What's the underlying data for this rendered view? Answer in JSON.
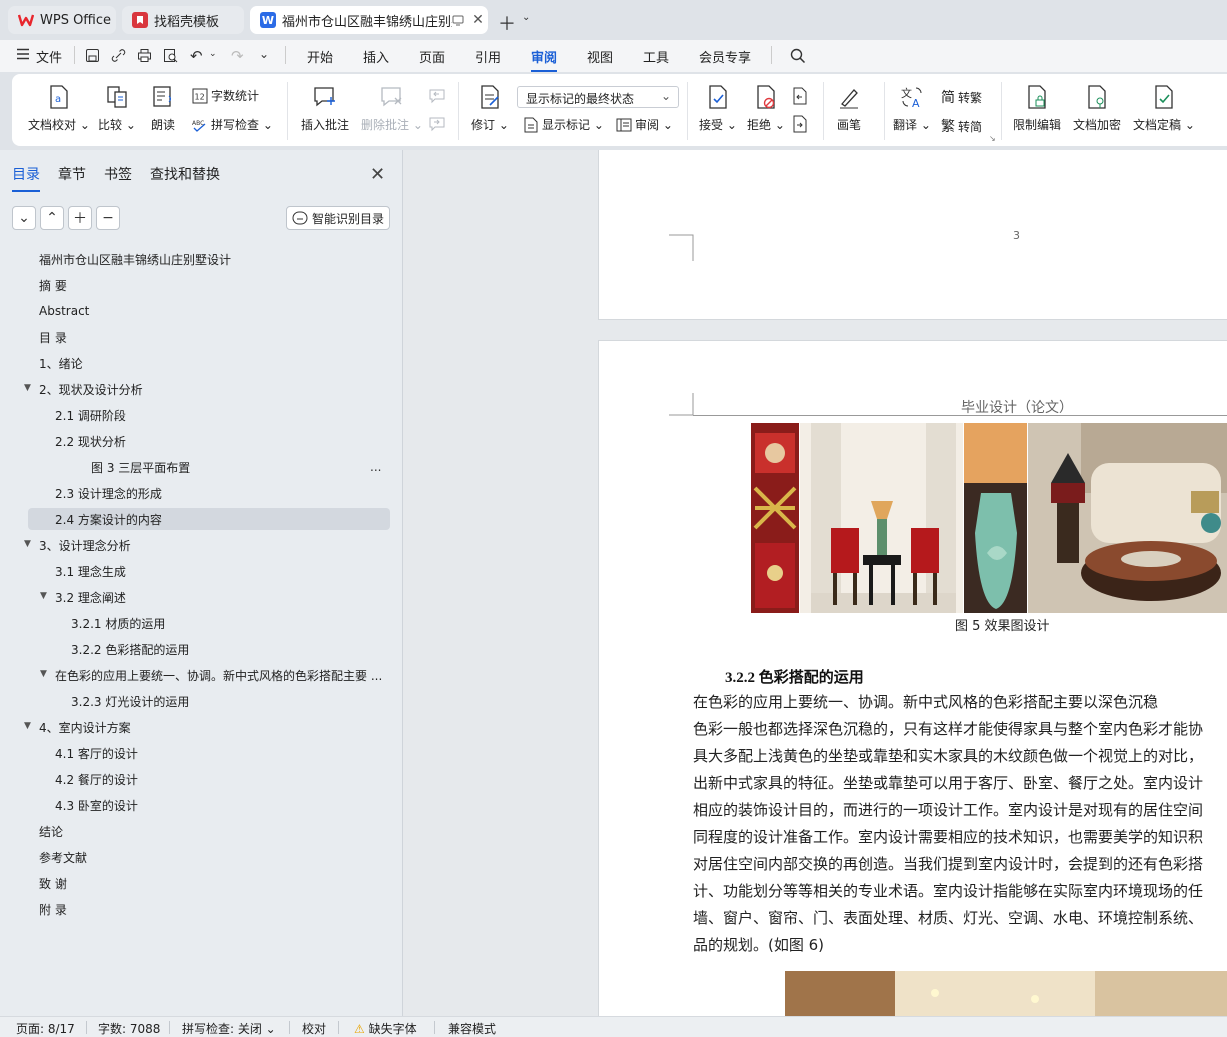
{
  "tabs": [
    {
      "label": "WPS Office"
    },
    {
      "label": "找稻壳模板"
    },
    {
      "label": "福州市仓山区融丰锦绣山庄别墅"
    }
  ],
  "menu": {
    "file": "文件",
    "items": [
      "开始",
      "插入",
      "页面",
      "引用",
      "审阅",
      "视图",
      "工具",
      "会员专享"
    ],
    "active": "审阅"
  },
  "ribbon": {
    "doc_check": "文档校对",
    "compare": "比较",
    "read_aloud": "朗读",
    "word_count": "字数统计",
    "spell_check": "拼写检查",
    "insert_comment": "插入批注",
    "delete_comment": "删除批注",
    "revise": "修订",
    "show_markup_state": "显示标记的最终状态",
    "show_markup": "显示标记",
    "review": "审阅",
    "accept": "接受",
    "reject": "拒绝",
    "pen": "画笔",
    "translate": "翻译",
    "to_traditional": "转繁",
    "to_simplified": "转简",
    "restrict_edit": "限制编辑",
    "encrypt": "文档加密",
    "finalize": "文档定稿",
    "trad_char": "简",
    "simp_char": "繁"
  },
  "nav": {
    "tabs": [
      "目录",
      "章节",
      "书签",
      "查找和替换"
    ],
    "smart_toc": "智能识别目录",
    "toc": [
      {
        "label": "福州市仓山区融丰锦绣山庄别墅设计",
        "level": 1
      },
      {
        "label": "摘    要",
        "level": 1
      },
      {
        "label": "Abstract",
        "level": 1
      },
      {
        "label": "目  录",
        "level": 1
      },
      {
        "label": "1、绪论",
        "level": 1
      },
      {
        "label": "2、现状及设计分析",
        "level": 1,
        "expanded": true
      },
      {
        "label": "2.1 调研阶段",
        "level": 2
      },
      {
        "label": "2.2 现状分析",
        "level": 2
      },
      {
        "label": "图 3 三层平面布置",
        "level": 4
      },
      {
        "label": "2.3 设计理念的形成",
        "level": 2
      },
      {
        "label": "2.4 方案设计的内容",
        "level": 2,
        "current": true
      },
      {
        "label": "3、设计理念分析",
        "level": 1,
        "expanded": true
      },
      {
        "label": "3.1 理念生成",
        "level": 2
      },
      {
        "label": "3.2 理念阐述",
        "level": 2,
        "expanded": true
      },
      {
        "label": "3.2.1 材质的运用",
        "level": 3
      },
      {
        "label": "3.2.2 色彩搭配的运用",
        "level": 3
      },
      {
        "label": "在色彩的应用上要统一、协调。新中式风格的色彩搭配主要 ...",
        "level": 2,
        "expanded": true
      },
      {
        "label": "3.2.3 灯光设计的运用",
        "level": 3
      },
      {
        "label": "4、室内设计方案",
        "level": 1,
        "expanded": true
      },
      {
        "label": "4.1 客厅的设计",
        "level": 2
      },
      {
        "label": "4.2 餐厅的设计",
        "level": 2
      },
      {
        "label": "4.3 卧室的设计",
        "level": 2
      },
      {
        "label": "结论",
        "level": 1
      },
      {
        "label": "参考文献",
        "level": 1
      },
      {
        "label": "致  谢",
        "level": 1
      },
      {
        "label": "附  录",
        "level": 1
      }
    ],
    "more": "..."
  },
  "doc": {
    "page_number": "3",
    "header": "毕业设计（论文）",
    "caption": "图 5 效果图设计",
    "section": "3.2.2 色彩搭配的运用",
    "lines": [
      "    在色彩的应用上要统一、协调。新中式风格的色彩搭配主要以深色沉稳",
      "色彩一般也都选择深色沉稳的，只有这样才能使得家具与整个室内色彩才能协",
      "具大多配上浅黄色的坐垫或靠垫和实木家具的木纹颜色做一个视觉上的对比，",
      "出新中式家具的特征。坐垫或靠垫可以用于客厅、卧室、餐厅之处。室内设计",
      "相应的装饰设计目的，而进行的一项设计工作。室内设计是对现有的居住空间",
      "同程度的设计准备工作。室内设计需要相应的技术知识，也需要美学的知识积",
      "对居住空间内部交换的再创造。当我们提到室内设计时，会提到的还有色彩搭",
      "计、功能划分等等相关的专业术语。室内设计指能够在实际室内环境现场的任",
      "墙、窗户、窗帘、门、表面处理、材质、灯光、空调、水电、环境控制系统、",
      "品的规划。(如图 6)"
    ]
  },
  "status": {
    "page": "页面: 8/17",
    "words": "字数: 7088",
    "spell": "拼写检查: 关闭",
    "proof": "校对",
    "missing_font": "缺失字体",
    "compat": "兼容模式"
  },
  "colors": {
    "accent": "#1a5fd6",
    "wps_red": "#e8262d",
    "docer_red": "#d9363e",
    "writer_blue": "#2b6be6"
  }
}
